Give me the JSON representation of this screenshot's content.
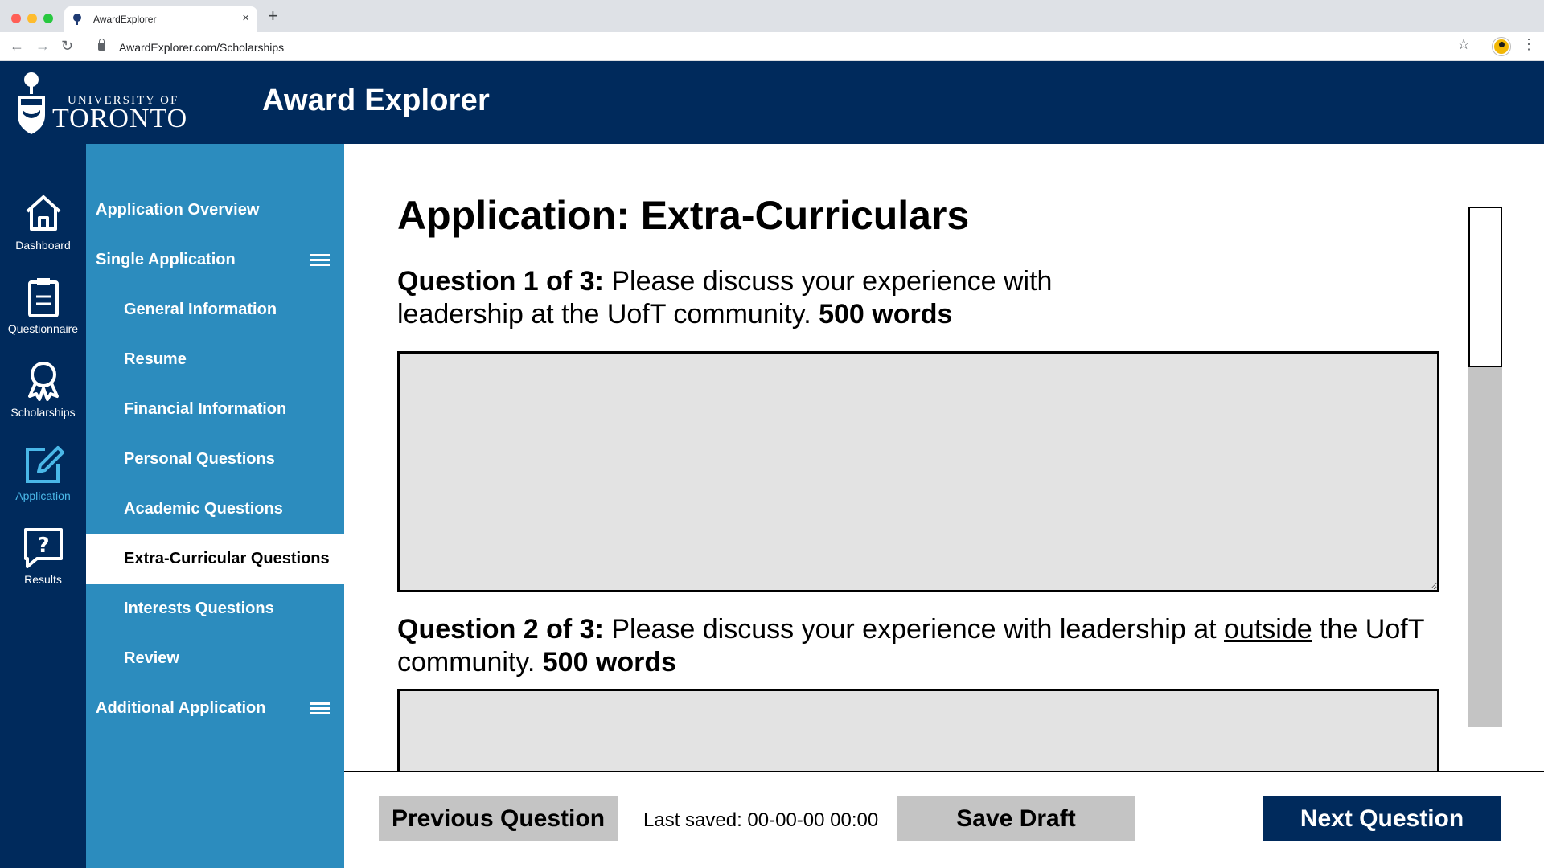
{
  "browser": {
    "tab_title": "AwardExplorer",
    "tab_close": "×",
    "new_tab": "+",
    "url": "AwardExplorer.com/Scholarships",
    "back": "←",
    "forward": "→",
    "reload": "↻",
    "star": "☆",
    "menu": "⋮"
  },
  "header": {
    "logo_line1": "UNIVERSITY OF",
    "logo_line2": "TORONTO",
    "app_title": "Award Explorer",
    "brand_color": "#002a5c"
  },
  "rail": {
    "items": [
      {
        "label": "Dashboard",
        "icon": "home-icon",
        "active": false
      },
      {
        "label": "Questionnaire",
        "icon": "clipboard-icon",
        "active": false
      },
      {
        "label": "Scholarships",
        "icon": "award-ribbon-icon",
        "active": false
      },
      {
        "label": "Application",
        "icon": "edit-pencil-icon",
        "active": true
      },
      {
        "label": "Results",
        "icon": "question-chat-icon",
        "active": false
      }
    ],
    "active_color": "#4ab8e8"
  },
  "side_nav": {
    "accent_color": "#2c8cbe",
    "items": [
      {
        "label": "Application Overview",
        "level": "section"
      },
      {
        "label": "Single Application",
        "level": "section",
        "icon": "hamburger-menu-icon"
      },
      {
        "label": "General Information",
        "level": "sub"
      },
      {
        "label": "Resume",
        "level": "sub"
      },
      {
        "label": "Financial Information",
        "level": "sub"
      },
      {
        "label": "Personal Questions",
        "level": "sub"
      },
      {
        "label": "Academic Questions",
        "level": "sub"
      },
      {
        "label": "Extra-Curricular Questions",
        "level": "sub",
        "current": true
      },
      {
        "label": "Interests Questions",
        "level": "sub"
      },
      {
        "label": "Review",
        "level": "sub"
      },
      {
        "label": "Additional Application",
        "level": "section",
        "icon": "hamburger-menu-icon"
      }
    ]
  },
  "main": {
    "title": "Application: Extra-Curriculars",
    "questions": [
      {
        "prefix": "Question 1 of 3:",
        "text": " Please discuss your experience with leadership at the UofT community. ",
        "words": "500 words",
        "answer": ""
      },
      {
        "prefix": "Question 2 of 3:",
        "text_before": " Please discuss your experience with leadership at ",
        "emphasis": "outside",
        "text_after": " the UofT community. ",
        "words": "500 words",
        "answer": ""
      }
    ]
  },
  "footer": {
    "prev_label": "Previous Question",
    "last_saved": "Last saved: 00-00-00 00:00",
    "save_label": "Save Draft",
    "next_label": "Next Question"
  }
}
